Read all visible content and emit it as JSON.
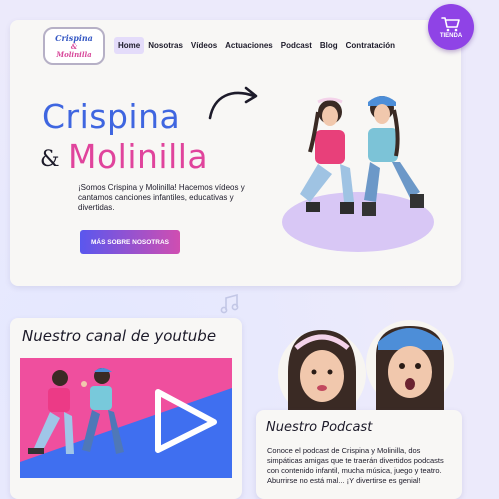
{
  "brand": {
    "logo_line1": "Crispina",
    "logo_line2": "&",
    "logo_line3": "Molinilla"
  },
  "nav": {
    "items": [
      {
        "label": "Home",
        "active": true
      },
      {
        "label": "Nosotras",
        "active": false
      },
      {
        "label": "Vídeos",
        "active": false
      },
      {
        "label": "Actuaciones",
        "active": false
      },
      {
        "label": "Podcast",
        "active": false
      },
      {
        "label": "Blog",
        "active": false
      },
      {
        "label": "Contratación",
        "active": false
      }
    ]
  },
  "shop": {
    "label": "TIENDA",
    "icon": "cart-icon"
  },
  "hero": {
    "title_part1": "Crispina",
    "ampersand": "&",
    "title_part2": "Molinilla",
    "description": "¡Somos Crispina y Molinilla! Hacemos vídeos y cantamos canciones infantiles, educativas y divertidas.",
    "cta_label": "MÁS SOBRE NOSOTRAS"
  },
  "youtube": {
    "title": "Nuestro canal de youtube",
    "play_icon": "play-icon"
  },
  "podcast": {
    "title": "Nuestro Podcast",
    "description": "Conoce el podcast de Crispina y Molinilla, dos simpáticas amigas que te traerán divertidos podcasts con contenido infantil, mucha música, juego y teatro. Aburrirse no está mal... ¡Y divertirse es genial!"
  },
  "colors": {
    "background": "#eceafb",
    "accent_blue": "#3f66e0",
    "accent_pink": "#e0449c",
    "shop_purple": "#8f43e6"
  }
}
